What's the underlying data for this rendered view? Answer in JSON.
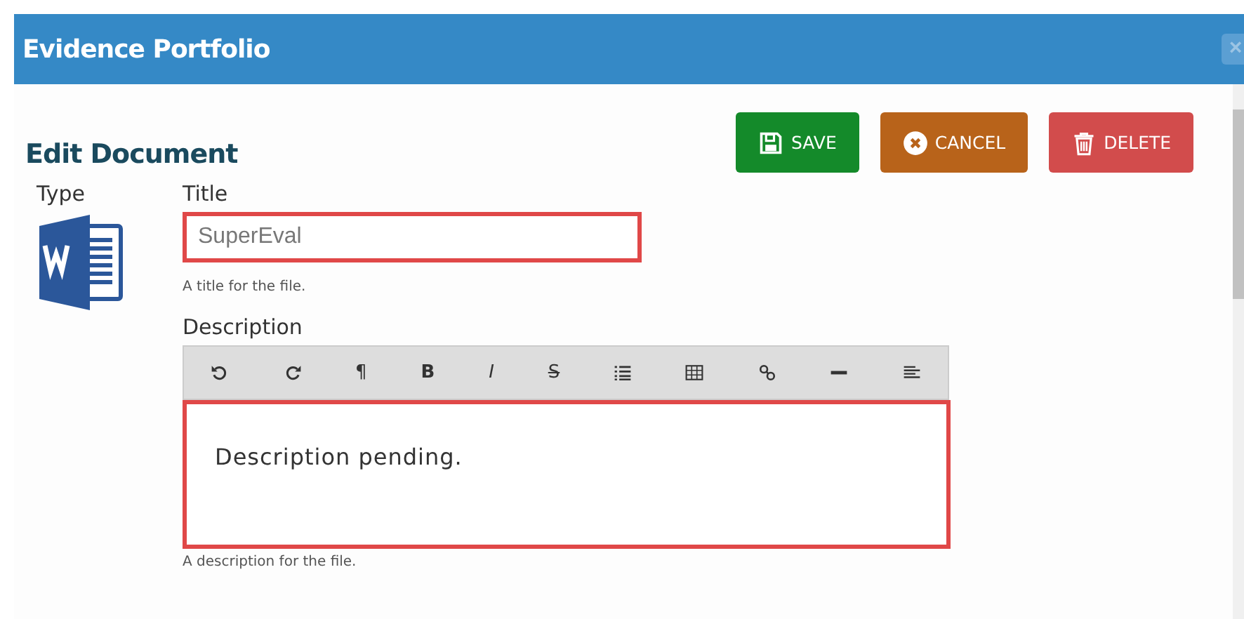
{
  "window": {
    "title": "Evidence Portfolio",
    "close": "×"
  },
  "heading": "Edit Document",
  "buttons": [
    {
      "label": "SAVE",
      "kind": "save"
    },
    {
      "label": "CANCEL",
      "kind": "cancel"
    },
    {
      "label": "DELETE",
      "kind": "delete"
    }
  ],
  "type_label": "Type",
  "title_field": {
    "label": "Title",
    "value": "SuperEval",
    "help": "A title for the file."
  },
  "description": {
    "label": "Description",
    "value": "Description pending.",
    "help": "A description for the file.",
    "toolbar": [
      "¶",
      "B",
      "I",
      "S"
    ]
  }
}
